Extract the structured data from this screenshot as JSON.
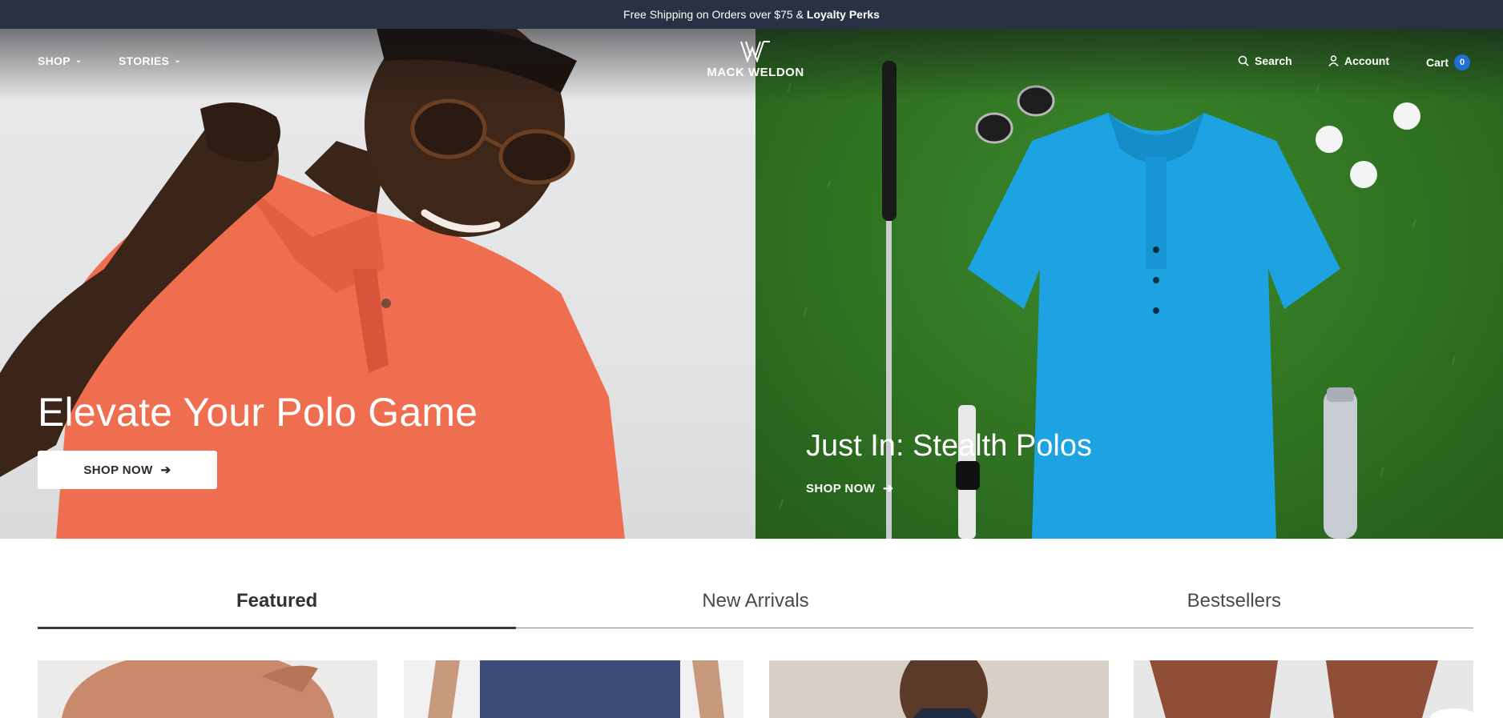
{
  "announcement": {
    "text": "Free Shipping on Orders over $75 &",
    "bold": "Loyalty Perks"
  },
  "nav": {
    "shop": "SHOP",
    "stories": "STORIES",
    "logo_text": "MACK WELDON",
    "search": "Search",
    "account": "Account",
    "cart": "Cart",
    "cart_count": "0"
  },
  "hero": {
    "left": {
      "title": "Elevate Your Polo Game",
      "cta": "SHOP NOW"
    },
    "right": {
      "title": "Just In: Stealth Polos",
      "cta": "SHOP NOW"
    }
  },
  "tabs": [
    {
      "label": "Featured",
      "active": true
    },
    {
      "label": "New Arrivals",
      "active": false
    },
    {
      "label": "Bestsellers",
      "active": false
    }
  ],
  "colors": {
    "announcement_bg": "#283244",
    "cart_badge": "#1e6fd6",
    "polo_orange": "#ef6e4f",
    "polo_blue": "#1ea3e2",
    "grass_green": "#2f7222"
  },
  "icons": {
    "search": "search-icon",
    "account": "user-icon",
    "chevron": "chevron-down-icon",
    "arrow": "arrow-right-icon"
  }
}
